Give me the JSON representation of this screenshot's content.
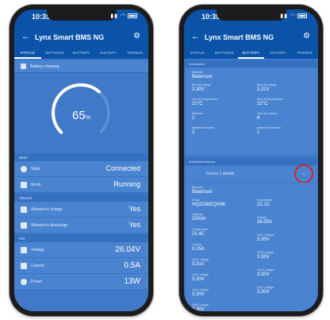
{
  "left": {
    "statusbar": {
      "time": "10:35"
    },
    "appbar": {
      "title": "Lynx Smart BMS NG"
    },
    "tabs": [
      "STATUS",
      "SETTINGS",
      "BATTERY",
      "HISTORY",
      "TRENDS"
    ],
    "active_tab": 0,
    "status_row": "Battery charging",
    "gauge": {
      "value": "65",
      "unit": "%",
      "fraction": 0.65
    },
    "sections": {
      "state": "State",
      "allowed": "Allowed",
      "info": "Info"
    },
    "rows": [
      {
        "icon": "state-icon",
        "label": "State",
        "value": "Connected"
      },
      {
        "icon": "mode-icon",
        "label": "Mode",
        "value": "Running"
      },
      {
        "icon": "allow-charge-icon",
        "label": "Allowed to charge",
        "value": "Yes"
      },
      {
        "icon": "allow-discharge-icon",
        "label": "Allowed to discharge",
        "value": "Yes"
      },
      {
        "icon": "voltage-icon",
        "label": "Voltage",
        "value": "26.04V"
      },
      {
        "icon": "current-icon",
        "label": "Current",
        "value": "0.5A"
      },
      {
        "icon": "power-icon",
        "label": "Power",
        "value": "13W"
      }
    ]
  },
  "right": {
    "statusbar": {
      "time": "10:35"
    },
    "appbar": {
      "title": "Lynx Smart BMS NG"
    },
    "tabs": [
      "STATUS",
      "SETTINGS",
      "BATTERY",
      "HISTORY",
      "TRENDS"
    ],
    "active_tab": 2,
    "section_info": "Information",
    "info": [
      {
        "k": "Balancer",
        "v": "Balanced"
      },
      {
        "k": "Min cell voltage",
        "v": "3.30V"
      },
      {
        "k": "Max cell voltage",
        "v": "3.31V"
      },
      {
        "k": "Min cell temperature",
        "v": "21°C"
      },
      {
        "k": "Max cell temperature",
        "v": "22°C"
      },
      {
        "k": "Batteries",
        "v": "2"
      },
      {
        "k": "Cells per battery",
        "v": "8"
      },
      {
        "k": "Batteries in series",
        "v": "2"
      },
      {
        "k": "Batteries in parallel",
        "v": "1"
      }
    ],
    "section_batteries": "Individual batteries",
    "expander_label": "Device 1 details",
    "battery": [
      {
        "k": "Balancer",
        "v": "Balanced"
      },
      {
        "k": "Serial",
        "v": "HQ2208EQX4K"
      },
      {
        "k": "Capacity",
        "v": "200Ah"
      },
      {
        "k": "Temperature",
        "v": "21.1C"
      },
      {
        "k": "Temperature",
        "v": "21.4C"
      },
      {
        "k": "Voltage",
        "v": "26.05V"
      },
      {
        "k": "Current",
        "v": "0.25A"
      },
      {
        "k": "Cell 1 voltage",
        "v": "3.30V"
      },
      {
        "k": "Cell 2 voltage",
        "v": "3.31V"
      },
      {
        "k": "Cell 3 voltage",
        "v": "3.30V"
      },
      {
        "k": "Cell 4 voltage",
        "v": "3.30V"
      },
      {
        "k": "Cell 5 voltage",
        "v": "3.30V"
      },
      {
        "k": "Cell 6 voltage",
        "v": "3.30V"
      },
      {
        "k": "Cell 7 voltage",
        "v": "3.30V"
      },
      {
        "k": "Cell 8 voltage",
        "v": "3.30V"
      }
    ]
  },
  "colors": {
    "header": "#0a53a8",
    "background": "#3f79c7",
    "row": "#4a84d0",
    "highlight": "#d2232a"
  }
}
